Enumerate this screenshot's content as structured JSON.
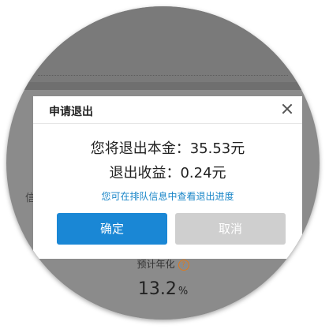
{
  "background": {
    "side_text": "信",
    "annual_label": "预计年化",
    "annual_value": "13.2",
    "annual_unit": "%"
  },
  "dialog": {
    "title": "申请退出",
    "principal_text": "您将退出本金：35.53元",
    "income_text": "退出收益：0.24元",
    "progress_link": "您可在排队信息中查看退出进度",
    "confirm_label": "确定",
    "cancel_label": "取消"
  },
  "icons": {
    "close": "close-icon",
    "help": "help-icon"
  },
  "colors": {
    "confirm": "#1a87d5",
    "cancel": "#cfcfcf",
    "link": "#1a86c8",
    "help": "#e07a1a"
  }
}
